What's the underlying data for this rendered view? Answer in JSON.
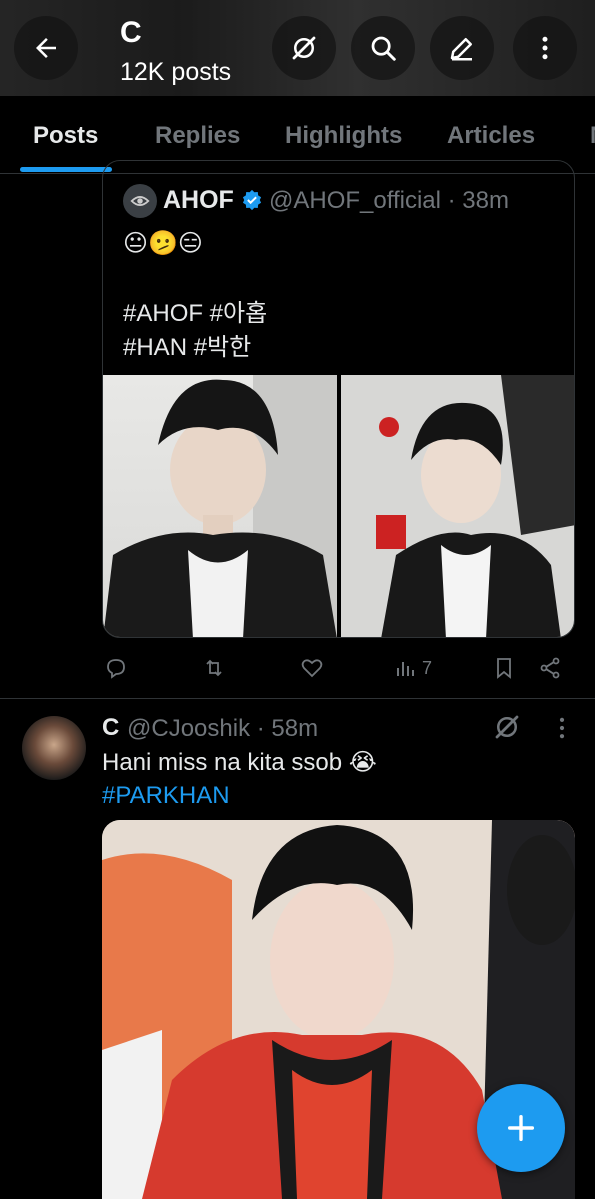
{
  "header": {
    "title": "C",
    "subtitle": "12K posts"
  },
  "tabs": [
    {
      "label": "Posts",
      "active": true
    },
    {
      "label": "Replies"
    },
    {
      "label": "Highlights"
    },
    {
      "label": "Articles"
    },
    {
      "label": "M"
    }
  ],
  "quote": {
    "author_name": "AHOF",
    "author_handle_time": "@AHOF_official · 38m",
    "avatar_text": "AHOF",
    "emojis": "😐🫤😑",
    "line1": "#AHOF #아홉",
    "line2": "#HAN #박한"
  },
  "actions": {
    "views": "7"
  },
  "post": {
    "author_name": "C",
    "author_handle_time": "@CJooshik · 58m",
    "text": "Hani miss na kita ssob 😭",
    "hashtag": "#PARKHAN"
  },
  "colors": {
    "accent": "#1d9bf0",
    "muted": "#71767b",
    "text": "#e7e9ea",
    "border": "#2f3336"
  }
}
